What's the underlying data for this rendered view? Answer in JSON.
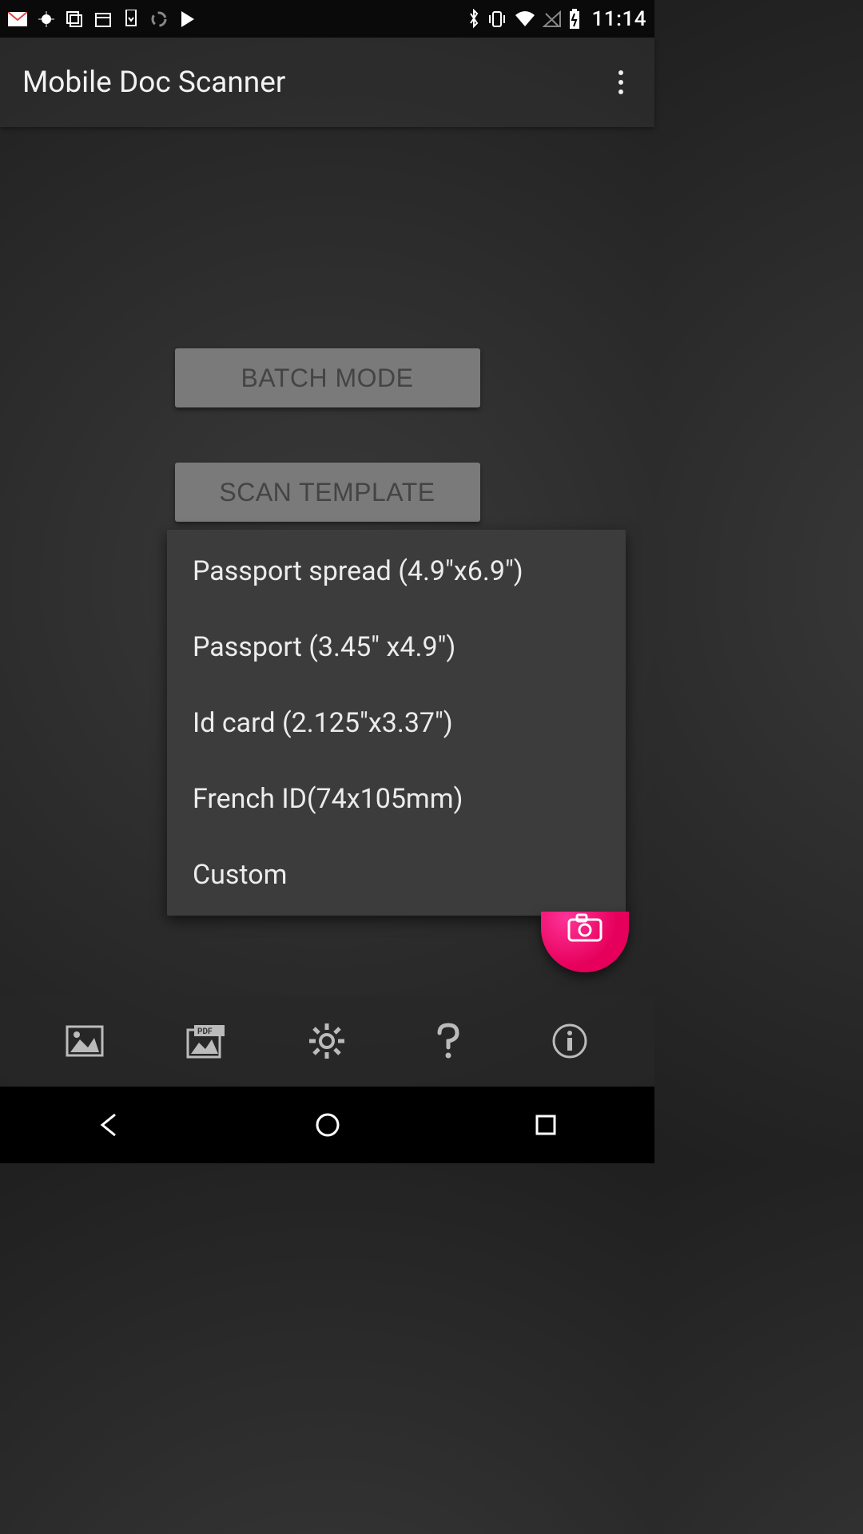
{
  "status": {
    "time": "11:14"
  },
  "header": {
    "title": "Mobile Doc Scanner"
  },
  "main": {
    "batch_mode_label": "BATCH MODE",
    "scan_template_label": "SCAN TEMPLATE",
    "dropdown": [
      "Passport spread (4.9\"x6.9\")",
      "Passport (3.45\" x4.9\")",
      "Id card (2.125\"x3.37\")",
      "French ID(74x105mm)",
      "Custom"
    ]
  },
  "colors": {
    "accent": "#e6005c"
  }
}
